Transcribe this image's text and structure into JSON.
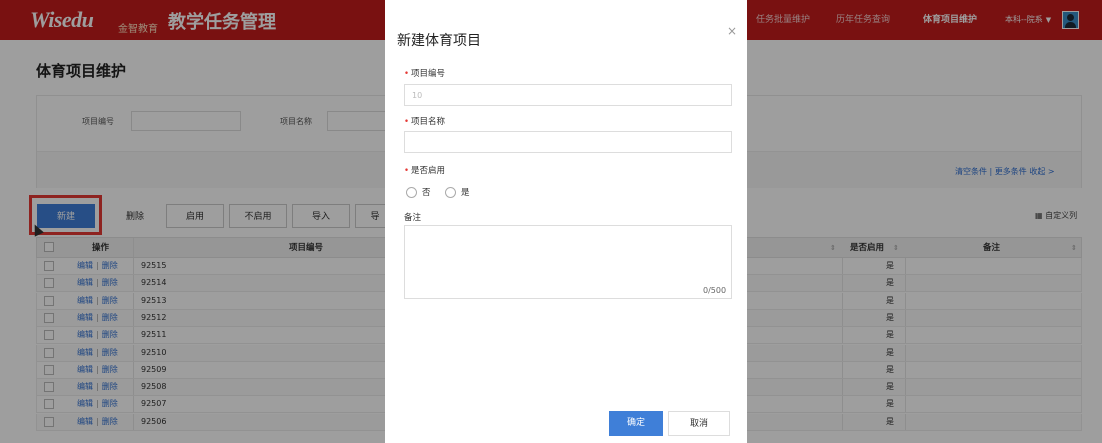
{
  "header": {
    "logo": "Wisedu",
    "logo_sub": "金智教育",
    "app_title": "教学任务管理",
    "nav": [
      "任务批量维护",
      "历年任务查询",
      "体育项目维护"
    ],
    "active_nav": "体育项目维护",
    "user_select": "本科--院系"
  },
  "page": {
    "title": "体育项目维护",
    "filters": {
      "code_label": "项目编号",
      "name_label": "项目名称"
    },
    "filter_links": "清空条件 | 更多条件 收起 >",
    "toolbar": {
      "new": "新建",
      "delete": "删除",
      "enable": "启用",
      "disable": "不启用",
      "import": "导入",
      "export": "导"
    },
    "custom_columns": "自定义列",
    "table": {
      "headers": {
        "op": "操作",
        "code": "项目编号",
        "enabled": "是否启用",
        "remark": "备注"
      },
      "op_edit": "编辑",
      "op_delete": "删除",
      "rows": [
        {
          "code": "92515",
          "enabled": "是"
        },
        {
          "code": "92514",
          "enabled": "是"
        },
        {
          "code": "92513",
          "enabled": "是"
        },
        {
          "code": "92512",
          "enabled": "是"
        },
        {
          "code": "92511",
          "enabled": "是"
        },
        {
          "code": "92510",
          "enabled": "是"
        },
        {
          "code": "92509",
          "enabled": "是"
        },
        {
          "code": "92508",
          "enabled": "是"
        },
        {
          "code": "92507",
          "enabled": "是"
        },
        {
          "code": "92506",
          "enabled": "是"
        }
      ]
    }
  },
  "modal": {
    "title": "新建体育项目",
    "fields": {
      "code_label": "项目编号",
      "code_placeholder": "10",
      "name_label": "项目名称",
      "enabled_label": "是否启用",
      "enabled_options": [
        "否",
        "是"
      ],
      "remark_label": "备注",
      "remark_counter": "0/500"
    },
    "ok": "确定",
    "cancel": "取消"
  },
  "colors": {
    "header_red": "#c41c1c",
    "primary_blue": "#3f7fd8",
    "highlight_red": "#e53935",
    "link_blue": "#2f6fd1"
  }
}
